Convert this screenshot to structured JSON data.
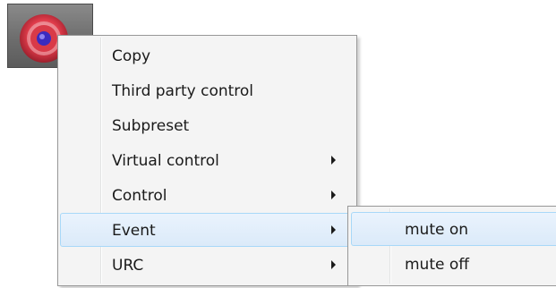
{
  "app_icon": {
    "icon": "target-record-icon",
    "colors": {
      "ring_red": "#e03c4b",
      "center_blue": "#3b2bbf",
      "background": "#737373"
    }
  },
  "context_menu": {
    "items": [
      {
        "label": "Copy",
        "has_submenu": false
      },
      {
        "label": "Third party control",
        "has_submenu": false
      },
      {
        "label": "Subpreset",
        "has_submenu": false
      },
      {
        "label": "Virtual control",
        "has_submenu": true
      },
      {
        "label": "Control",
        "has_submenu": true
      },
      {
        "label": "Event",
        "has_submenu": true,
        "highlighted": true
      },
      {
        "label": "URC",
        "has_submenu": true
      }
    ]
  },
  "submenu": {
    "parent": "Event",
    "items": [
      {
        "label": "mute on",
        "highlighted": true
      },
      {
        "label": "mute off"
      }
    ]
  },
  "colors": {
    "menu_background": "#f4f4f4",
    "menu_border": "#979797",
    "highlight_fill": "#dbeaf9",
    "highlight_border": "#a8d8f8"
  }
}
